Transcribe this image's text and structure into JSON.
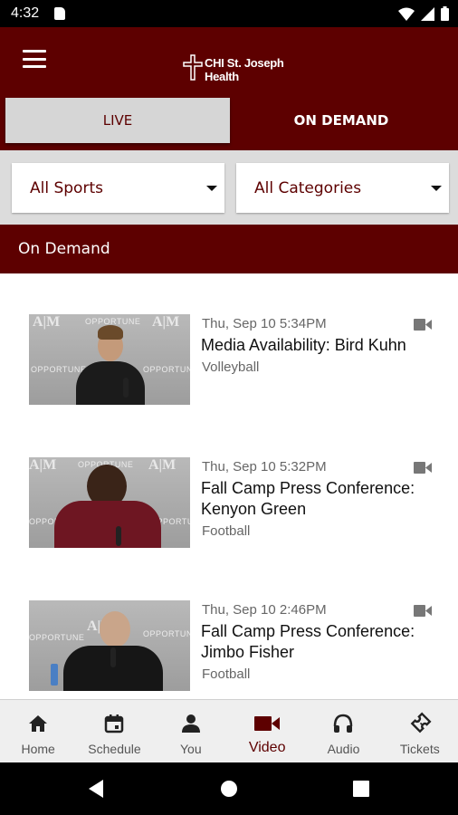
{
  "status_bar": {
    "time": "4:32"
  },
  "header": {
    "logo_line1": "CHI St. Joseph",
    "logo_line2": "Health"
  },
  "tabs": [
    {
      "label": "LIVE",
      "selected": false
    },
    {
      "label": "ON DEMAND",
      "selected": true
    }
  ],
  "filters": {
    "sports": "All Sports",
    "categories": "All Categories"
  },
  "section": {
    "title": "On Demand"
  },
  "videos": [
    {
      "date": "Thu, Sep 10 5:34PM",
      "title": "Media Availability: Bird Kuhn",
      "category": "Volleyball"
    },
    {
      "date": "Thu, Sep 10 5:32PM",
      "title": "Fall Camp Press Conference: Kenyon Green",
      "category": "Football"
    },
    {
      "date": "Thu, Sep 10 2:46PM",
      "title": "Fall Camp Press Conference: Jimbo Fisher",
      "category": "Football"
    }
  ],
  "thumb_text": {
    "brand_mark": "A|M",
    "sponsor": "OPPORTUNE"
  },
  "bottom_nav": [
    {
      "label": "Home",
      "icon": "home-icon"
    },
    {
      "label": "Schedule",
      "icon": "calendar-icon"
    },
    {
      "label": "You",
      "icon": "person-icon"
    },
    {
      "label": "Video",
      "icon": "video-camera-icon",
      "active": true
    },
    {
      "label": "Audio",
      "icon": "headphones-icon"
    },
    {
      "label": "Tickets",
      "icon": "ticket-icon"
    }
  ],
  "colors": {
    "brand": "#5d0000",
    "tab_selected_bg": "#d6d6d6",
    "filter_bg": "#dcdcdc",
    "nav_bg": "#efefef"
  }
}
